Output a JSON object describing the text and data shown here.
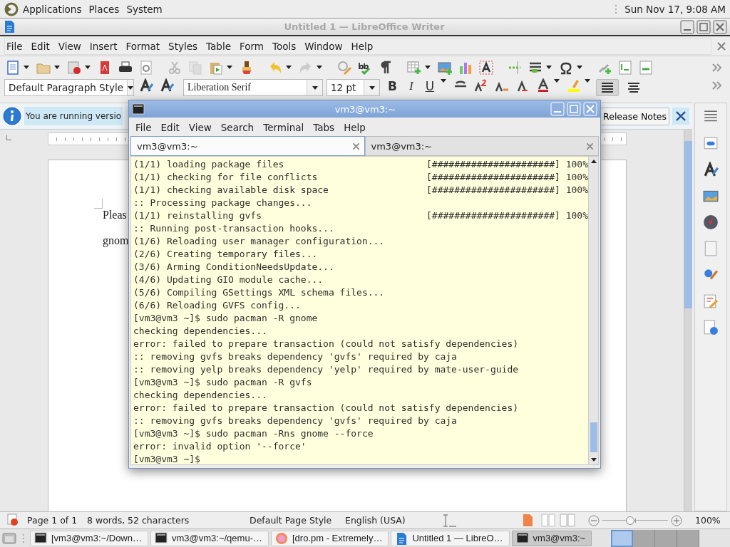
{
  "top_panel": {
    "menus": [
      "Applications",
      "Places",
      "System"
    ],
    "clock": "Sun Nov 17, 9:08 AM"
  },
  "writer": {
    "title": "Untitled 1 — LibreOffice Writer",
    "menus": [
      "File",
      "Edit",
      "View",
      "Insert",
      "Format",
      "Styles",
      "Table",
      "Form",
      "Tools",
      "Window",
      "Help"
    ],
    "paragraph_style": "Default Paragraph Style",
    "font_name": "Liberation Serif",
    "font_size": "12 pt",
    "format_buttons": [
      "B",
      "I",
      "U"
    ],
    "align_buttons": [
      {
        "selected": true
      },
      {
        "selected": false
      }
    ],
    "infobar": {
      "message": "You are running versio",
      "button": "Release Notes"
    },
    "document": {
      "lines": [
        "Pleas",
        "gnom"
      ]
    },
    "status_bar": {
      "page": "Page 1 of 1",
      "words": "8 words, 52 characters",
      "page_style": "Default Page Style",
      "language": "English (USA)",
      "view_modes": [
        {
          "selected": true
        },
        {
          "selected": false
        },
        {
          "selected": false
        }
      ],
      "zoom": {
        "level": 0.42,
        "reading": "100%"
      }
    }
  },
  "terminal": {
    "title": "vm3@vm3:~",
    "menus": [
      "File",
      "Edit",
      "View",
      "Search",
      "Terminal",
      "Tabs",
      "Help"
    ],
    "tabs": [
      {
        "label": "vm3@vm3:~",
        "selected": true
      },
      {
        "label": "vm3@vm3:~",
        "selected": false
      }
    ],
    "lines": [
      {
        "text": "(1/1) loading package files",
        "progress": "[######################] 100%"
      },
      {
        "text": "(1/1) checking for file conflicts",
        "progress": "[######################] 100%"
      },
      {
        "text": "(1/1) checking available disk space",
        "progress": "[######################] 100%"
      },
      {
        "text": ":: Processing package changes..."
      },
      {
        "text": "(1/1) reinstalling gvfs",
        "progress": "[######################] 100%"
      },
      {
        "text": ":: Running post-transaction hooks..."
      },
      {
        "text": "(1/6) Reloading user manager configuration..."
      },
      {
        "text": "(2/6) Creating temporary files..."
      },
      {
        "text": "(3/6) Arming ConditionNeedsUpdate..."
      },
      {
        "text": "(4/6) Updating GIO module cache..."
      },
      {
        "text": "(5/6) Compiling GSettings XML schema files..."
      },
      {
        "text": "(6/6) Reloading GVFS config..."
      },
      {
        "text": "[vm3@vm3 ~]$ sudo pacman -R gnome"
      },
      {
        "text": "checking dependencies..."
      },
      {
        "text": "error: failed to prepare transaction (could not satisfy dependencies)"
      },
      {
        "text": ":: removing gvfs breaks dependency 'gvfs' required by caja"
      },
      {
        "text": ":: removing yelp breaks dependency 'yelp' required by mate-user-guide"
      },
      {
        "text": "[vm3@vm3 ~]$ sudo pacman -R gvfs"
      },
      {
        "text": "checking dependencies..."
      },
      {
        "text": "error: failed to prepare transaction (could not satisfy dependencies)"
      },
      {
        "text": ":: removing gvfs breaks dependency 'gvfs' required by caja"
      },
      {
        "text": "[vm3@vm3 ~]$ sudo pacman -Rns gnome --force"
      },
      {
        "text": "error: invalid option '--force'"
      },
      {
        "text": "[vm3@vm3 ~]$"
      }
    ]
  },
  "taskbar": {
    "items": [
      {
        "kind": "terminal",
        "label": "[vm3@vm3:~/Down…",
        "selected": false
      },
      {
        "kind": "terminal",
        "label": "vm3@vm3:~/qemu-…",
        "selected": false
      },
      {
        "kind": "browser",
        "label": "[dro.pm - Extremely…",
        "selected": false
      },
      {
        "kind": "writer",
        "label": "Untitled 1 — LibreO…",
        "selected": false
      },
      {
        "kind": "terminal",
        "label": "vm3@vm3:~",
        "selected": true
      }
    ],
    "workspaces": [
      {
        "selected": true
      },
      {
        "selected": false
      },
      {
        "selected": false
      },
      {
        "selected": false
      }
    ]
  }
}
